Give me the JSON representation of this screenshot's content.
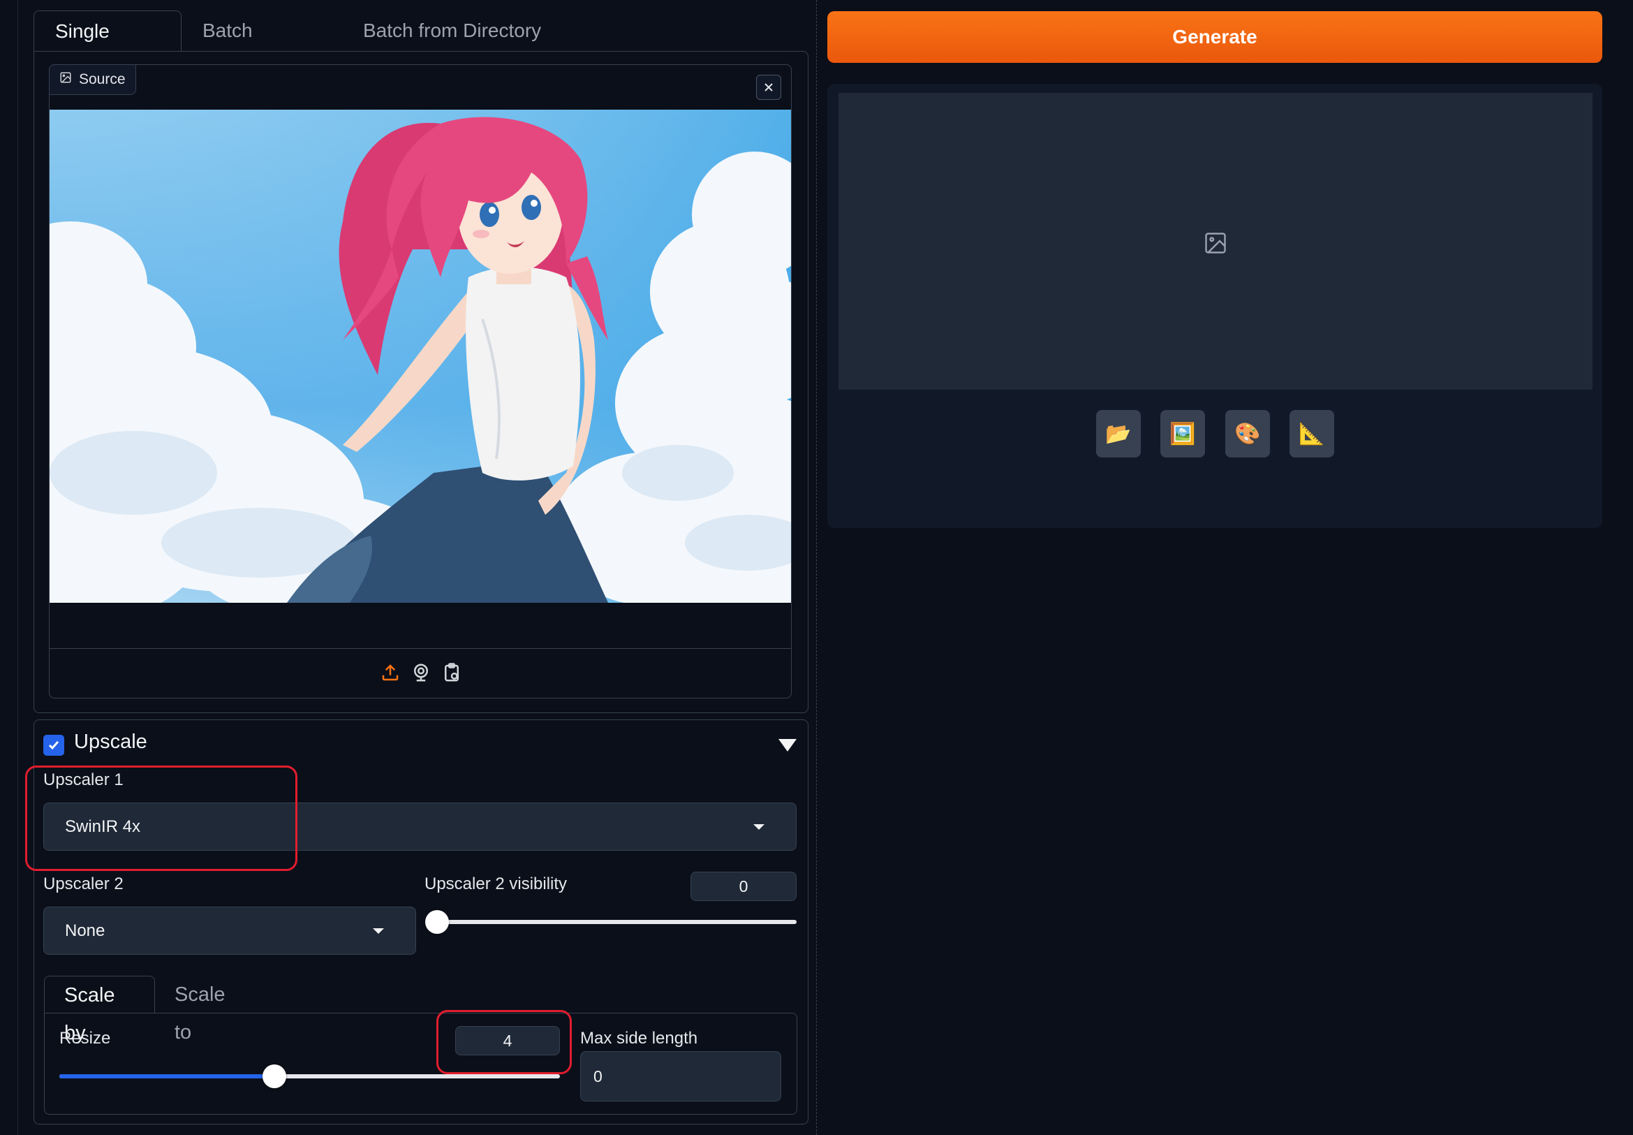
{
  "tabs": [
    {
      "label": "Single Image",
      "active": true
    },
    {
      "label": "Batch Process",
      "active": false
    },
    {
      "label": "Batch from Directory",
      "active": false
    }
  ],
  "source": {
    "label": "Source",
    "image_icon": "image-icon",
    "close_icon": "close-icon",
    "tools": [
      "upload-icon",
      "webcam-icon",
      "clipboard-icon"
    ]
  },
  "upscale": {
    "title": "Upscale",
    "enabled": true,
    "upscaler1": {
      "label": "Upscaler 1",
      "value": "SwinIR 4x"
    },
    "upscaler2": {
      "label": "Upscaler 2",
      "value": "None"
    },
    "visibility": {
      "label": "Upscaler 2 visibility",
      "value": "0",
      "fraction": 0
    },
    "scale_tabs": [
      {
        "label": "Scale by",
        "active": true
      },
      {
        "label": "Scale to",
        "active": false
      }
    ],
    "resize": {
      "label": "Resize",
      "value": "4",
      "fraction": 0.43
    },
    "max_side": {
      "label": "Max side length",
      "value": "0"
    }
  },
  "generate": {
    "label": "Generate"
  },
  "output": {
    "placeholder_icon": "image-placeholder-icon",
    "tools": [
      {
        "name": "open-folder-button",
        "glyph": "📂"
      },
      {
        "name": "send-to-image-button",
        "glyph": "🖼️"
      },
      {
        "name": "send-to-inpaint-button",
        "glyph": "🎨"
      },
      {
        "name": "send-to-extras-button",
        "glyph": "📐"
      }
    ]
  },
  "colors": {
    "accent": "#f97316",
    "highlight": "#e11d2f",
    "slider": "#2563eb"
  }
}
